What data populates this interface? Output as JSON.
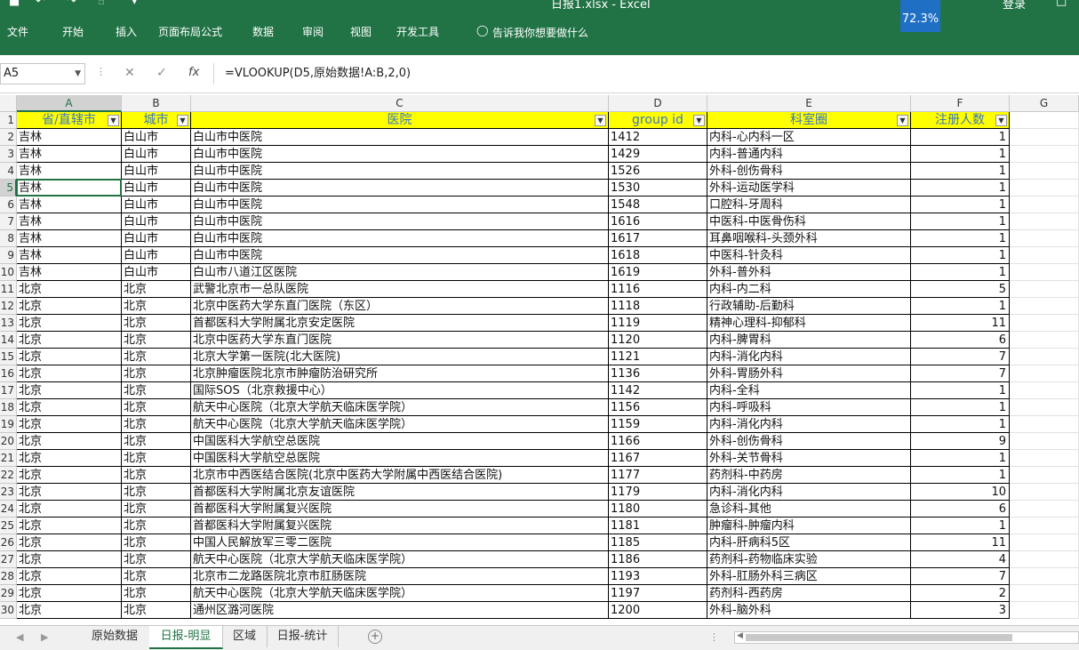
{
  "window": {
    "title": "日报1.xlsx - Excel",
    "user": "登录"
  },
  "quick_access": {
    "save_icon": "save-icon",
    "undo_icon": "undo-icon",
    "redo_icon": "redo-icon",
    "touch_icon": "touch-mode-icon"
  },
  "ribbon_tabs": [
    "文件",
    "开始",
    "插入",
    "页面布局",
    "公式",
    "数据",
    "审阅",
    "视图",
    "开发工具"
  ],
  "tell_me": "告诉我你想要做什么",
  "zoom_badge": "72.3%",
  "formula_bar": {
    "name_box": "A5",
    "formula": "=VLOOKUP(D5,原始数据!A:B,2,0)"
  },
  "column_letters": [
    "A",
    "B",
    "C",
    "D",
    "E",
    "F",
    "G"
  ],
  "headers": [
    "省/直辖市",
    "城市",
    "医院",
    "group id",
    "科室圈",
    "注册人数"
  ],
  "rows": [
    [
      "吉林",
      "白山市",
      "白山市中医院",
      "1412",
      "内科-心内科一区",
      "1"
    ],
    [
      "吉林",
      "白山市",
      "白山市中医院",
      "1429",
      "内科-普通内科",
      "1"
    ],
    [
      "吉林",
      "白山市",
      "白山市中医院",
      "1526",
      "外科-创伤骨科",
      "1"
    ],
    [
      "吉林",
      "白山市",
      "白山市中医院",
      "1530",
      "外科-运动医学科",
      "1"
    ],
    [
      "吉林",
      "白山市",
      "白山市中医院",
      "1548",
      "口腔科-牙周科",
      "1"
    ],
    [
      "吉林",
      "白山市",
      "白山市中医院",
      "1616",
      "中医科-中医骨伤科",
      "1"
    ],
    [
      "吉林",
      "白山市",
      "白山市中医院",
      "1617",
      "耳鼻咽喉科-头颈外科",
      "1"
    ],
    [
      "吉林",
      "白山市",
      "白山市中医院",
      "1618",
      "中医科-针灸科",
      "1"
    ],
    [
      "吉林",
      "白山市",
      "白山市八道江区医院",
      "1619",
      "外科-普外科",
      "1"
    ],
    [
      "北京",
      "北京",
      "武警北京市一总队医院",
      "1116",
      "内科-内二科",
      "5"
    ],
    [
      "北京",
      "北京",
      "北京中医药大学东直门医院（东区）",
      "1118",
      "行政辅助-后勤科",
      "1"
    ],
    [
      "北京",
      "北京",
      "首都医科大学附属北京安定医院",
      "1119",
      "精神心理科-抑郁科",
      "11"
    ],
    [
      "北京",
      "北京",
      "北京中医药大学东直门医院",
      "1120",
      "内科-脾胃科",
      "6"
    ],
    [
      "北京",
      "北京",
      "北京大学第一医院(北大医院)",
      "1121",
      "内科-消化内科",
      "7"
    ],
    [
      "北京",
      "北京",
      "北京肿瘤医院北京市肿瘤防治研究所",
      "1136",
      "外科-胃肠外科",
      "7"
    ],
    [
      "北京",
      "北京",
      "国际SOS（北京救援中心）",
      "1142",
      "内科-全科",
      "1"
    ],
    [
      "北京",
      "北京",
      "航天中心医院（北京大学航天临床医学院）",
      "1156",
      "内科-呼吸科",
      "1"
    ],
    [
      "北京",
      "北京",
      "航天中心医院（北京大学航天临床医学院）",
      "1159",
      "内科-消化内科",
      "1"
    ],
    [
      "北京",
      "北京",
      "中国医科大学航空总医院",
      "1166",
      "外科-创伤骨科",
      "9"
    ],
    [
      "北京",
      "北京",
      "中国医科大学航空总医院",
      "1167",
      "外科-关节骨科",
      "1"
    ],
    [
      "北京",
      "北京",
      "北京市中西医结合医院(北京中医药大学附属中西医结合医院)",
      "1177",
      "药剂科-中药房",
      "1"
    ],
    [
      "北京",
      "北京",
      "首都医科大学附属北京友谊医院",
      "1179",
      "内科-消化内科",
      "10"
    ],
    [
      "北京",
      "北京",
      "首都医科大学附属复兴医院",
      "1180",
      "急诊科-其他",
      "6"
    ],
    [
      "北京",
      "北京",
      "首都医科大学附属复兴医院",
      "1181",
      "肿瘤科-肿瘤内科",
      "1"
    ],
    [
      "北京",
      "北京",
      "中国人民解放军三零二医院",
      "1185",
      "内科-肝病科5区",
      "11"
    ],
    [
      "北京",
      "北京",
      "航天中心医院（北京大学航天临床医学院）",
      "1186",
      "药剂科-药物临床实验",
      "4"
    ],
    [
      "北京",
      "北京",
      "北京市二龙路医院北京市肛肠医院",
      "1193",
      "外科-肛肠外科三病区",
      "7"
    ],
    [
      "北京",
      "北京",
      "航天中心医院（北京大学航天临床医学院）",
      "1197",
      "药剂科-西药房",
      "2"
    ],
    [
      "北京",
      "北京",
      "通州区潞河医院",
      "1200",
      "外科-脑外科",
      "3"
    ]
  ],
  "sheet_tabs": [
    "原始数据",
    "日报-明显",
    "区域",
    "日报-统计"
  ],
  "active_sheet": "日报-明显"
}
